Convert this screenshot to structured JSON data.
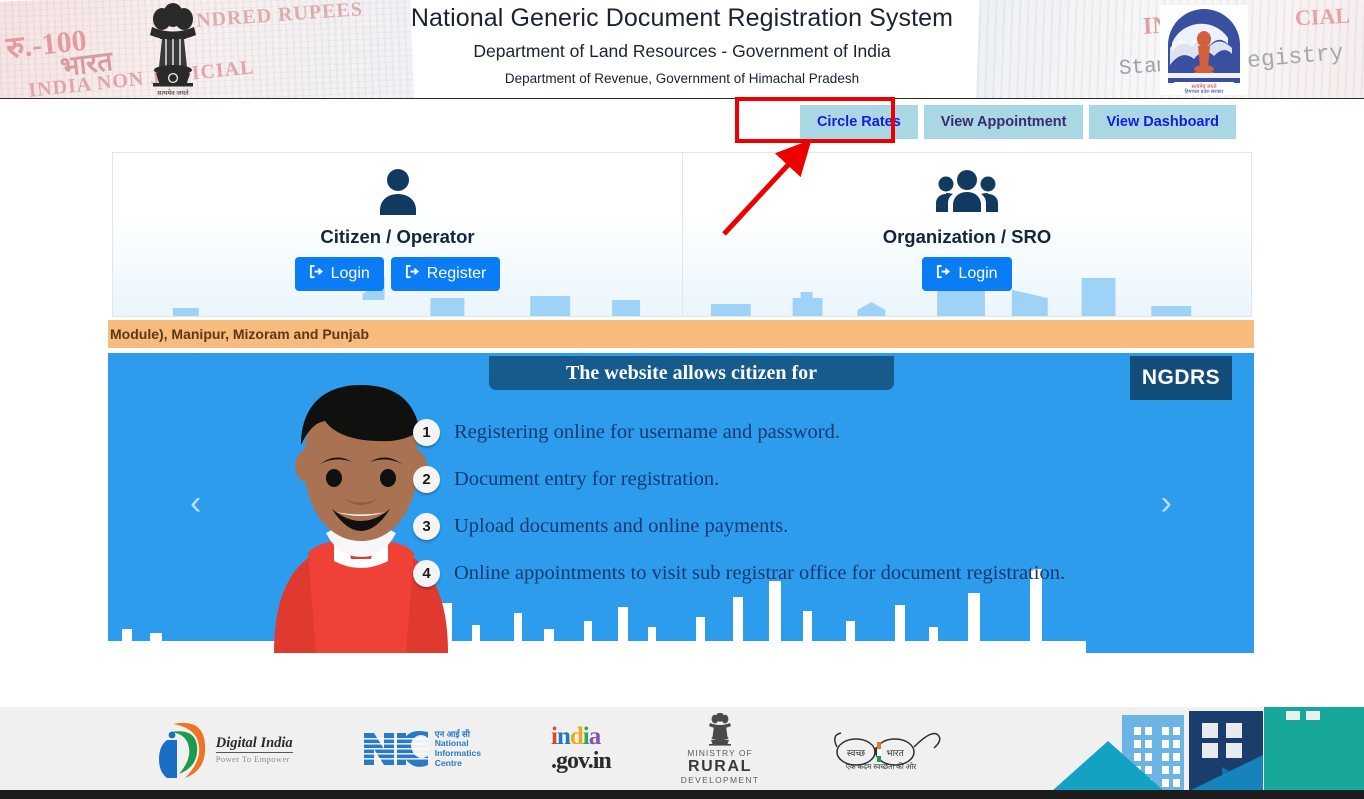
{
  "header": {
    "title": "National Generic Document Registration System",
    "subtitle": "Department of Land Resources - Government of India",
    "subtitle2": "Department of Revenue, Government of Himachal Pradesh",
    "watermarks": {
      "rupees100": "रु.-100",
      "hundred_rupees": "NDRED RUPEES",
      "bharat": "भारत",
      "india_non_judicial": "INDIA NON JUDICIAL",
      "india": "INDIA",
      "cial": "CIAL",
      "stamp": "Stamp",
      "registry": "egistry"
    },
    "emblem_motto": "सत्यमेव जयते"
  },
  "nav": {
    "buttons": [
      {
        "label": "Circle Rates",
        "style": "blue",
        "highlighted": true
      },
      {
        "label": "View Appointment",
        "style": "purple",
        "highlighted": false
      },
      {
        "label": "View Dashboard",
        "style": "blue",
        "highlighted": false
      }
    ],
    "highlight_color": "#ef0000",
    "button_bg": "#a9d7e4"
  },
  "cards": [
    {
      "icon": "user-icon",
      "title": "Citizen / Operator",
      "buttons": [
        {
          "label": "Login",
          "icon": "sign-in-icon"
        },
        {
          "label": "Register",
          "icon": "sign-in-icon"
        }
      ]
    },
    {
      "icon": "users-group-icon",
      "title": "Organization / SRO",
      "buttons": [
        {
          "label": "Login",
          "icon": "sign-in-icon"
        }
      ]
    }
  ],
  "marquee": {
    "text": "Module), Manipur, Mizoram and Punjab",
    "bg": "#f7bb7d"
  },
  "banner": {
    "heading": "The website allows citizen for",
    "badge": "NGDRS",
    "items": [
      {
        "num": "1",
        "text": "Registering online for username and password."
      },
      {
        "num": "2",
        "text": "Document entry for registration."
      },
      {
        "num": "3",
        "text": "Upload documents and online payments."
      },
      {
        "num": "4",
        "text": "Online appointments to visit sub registrar office for document registration."
      }
    ],
    "prev": "‹",
    "next": "›",
    "bg": "#2d9cec"
  },
  "footer": {
    "logos": [
      {
        "name": "digital-india",
        "title": "Digital India",
        "tagline": "Power To Empower"
      },
      {
        "name": "nic",
        "title": "NIC",
        "line_hi": "एन आई सी",
        "line1": "National",
        "line2": "Informatics",
        "line3": "Centre"
      },
      {
        "name": "india-gov-in",
        "title": "india",
        "sub": ".gov.in"
      },
      {
        "name": "ministry-of-rural-development",
        "line1": "MINISTRY OF",
        "line2": "RURAL",
        "line3": "DEVELOPMENT"
      },
      {
        "name": "swachh-bharat",
        "word1": "स्वच्छ",
        "word2": "भारत",
        "tagline": "एक कदम स्वच्छता की ओर"
      }
    ]
  },
  "annotation": {
    "arrow_color": "#ef0000",
    "points_to": "Circle Rates"
  }
}
